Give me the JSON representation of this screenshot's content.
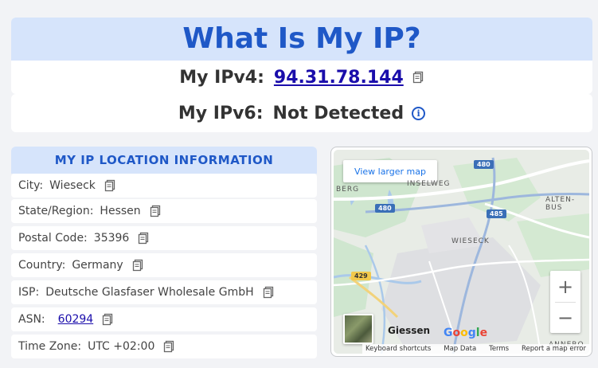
{
  "header": {
    "title": "What Is My IP?",
    "ipv4_label": "My IPv4:",
    "ipv4_value": "94.31.78.144",
    "ipv6_label": "My IPv6:",
    "ipv6_value": "Not Detected"
  },
  "location": {
    "heading": "MY IP LOCATION INFORMATION",
    "rows": [
      {
        "label": "City:",
        "value": "Wieseck"
      },
      {
        "label": "State/Region:",
        "value": "Hessen"
      },
      {
        "label": "Postal Code:",
        "value": "35396"
      },
      {
        "label": "Country:",
        "value": "Germany"
      },
      {
        "label": "ISP:",
        "value": "Deutsche Glasfaser Wholesale GmbH"
      },
      {
        "label": "ASN:",
        "value": "60294"
      },
      {
        "label": "Time Zone:",
        "value": "UTC +02:00"
      }
    ]
  },
  "map": {
    "larger_map_link": "View larger map",
    "zoom_in": "+",
    "zoom_out": "−",
    "labels": {
      "berg": "BERG",
      "inselweg": "INSELWEG",
      "alten_bus": "ALTEN-BUS",
      "wieseck": "WIESECK",
      "annero": "ANNERO"
    },
    "roads": {
      "r480_top": "480",
      "r480_left": "480",
      "r485": "485",
      "r429": "429"
    },
    "city": "Giessen",
    "google": "Google",
    "attribution": {
      "shortcuts": "Keyboard shortcuts",
      "map_data": "Map Data",
      "terms": "Terms",
      "report": "Report a map error"
    }
  },
  "colors": {
    "accent": "#1f58c7",
    "header_bg": "#d6e4fb",
    "link": "#1a0dab"
  }
}
